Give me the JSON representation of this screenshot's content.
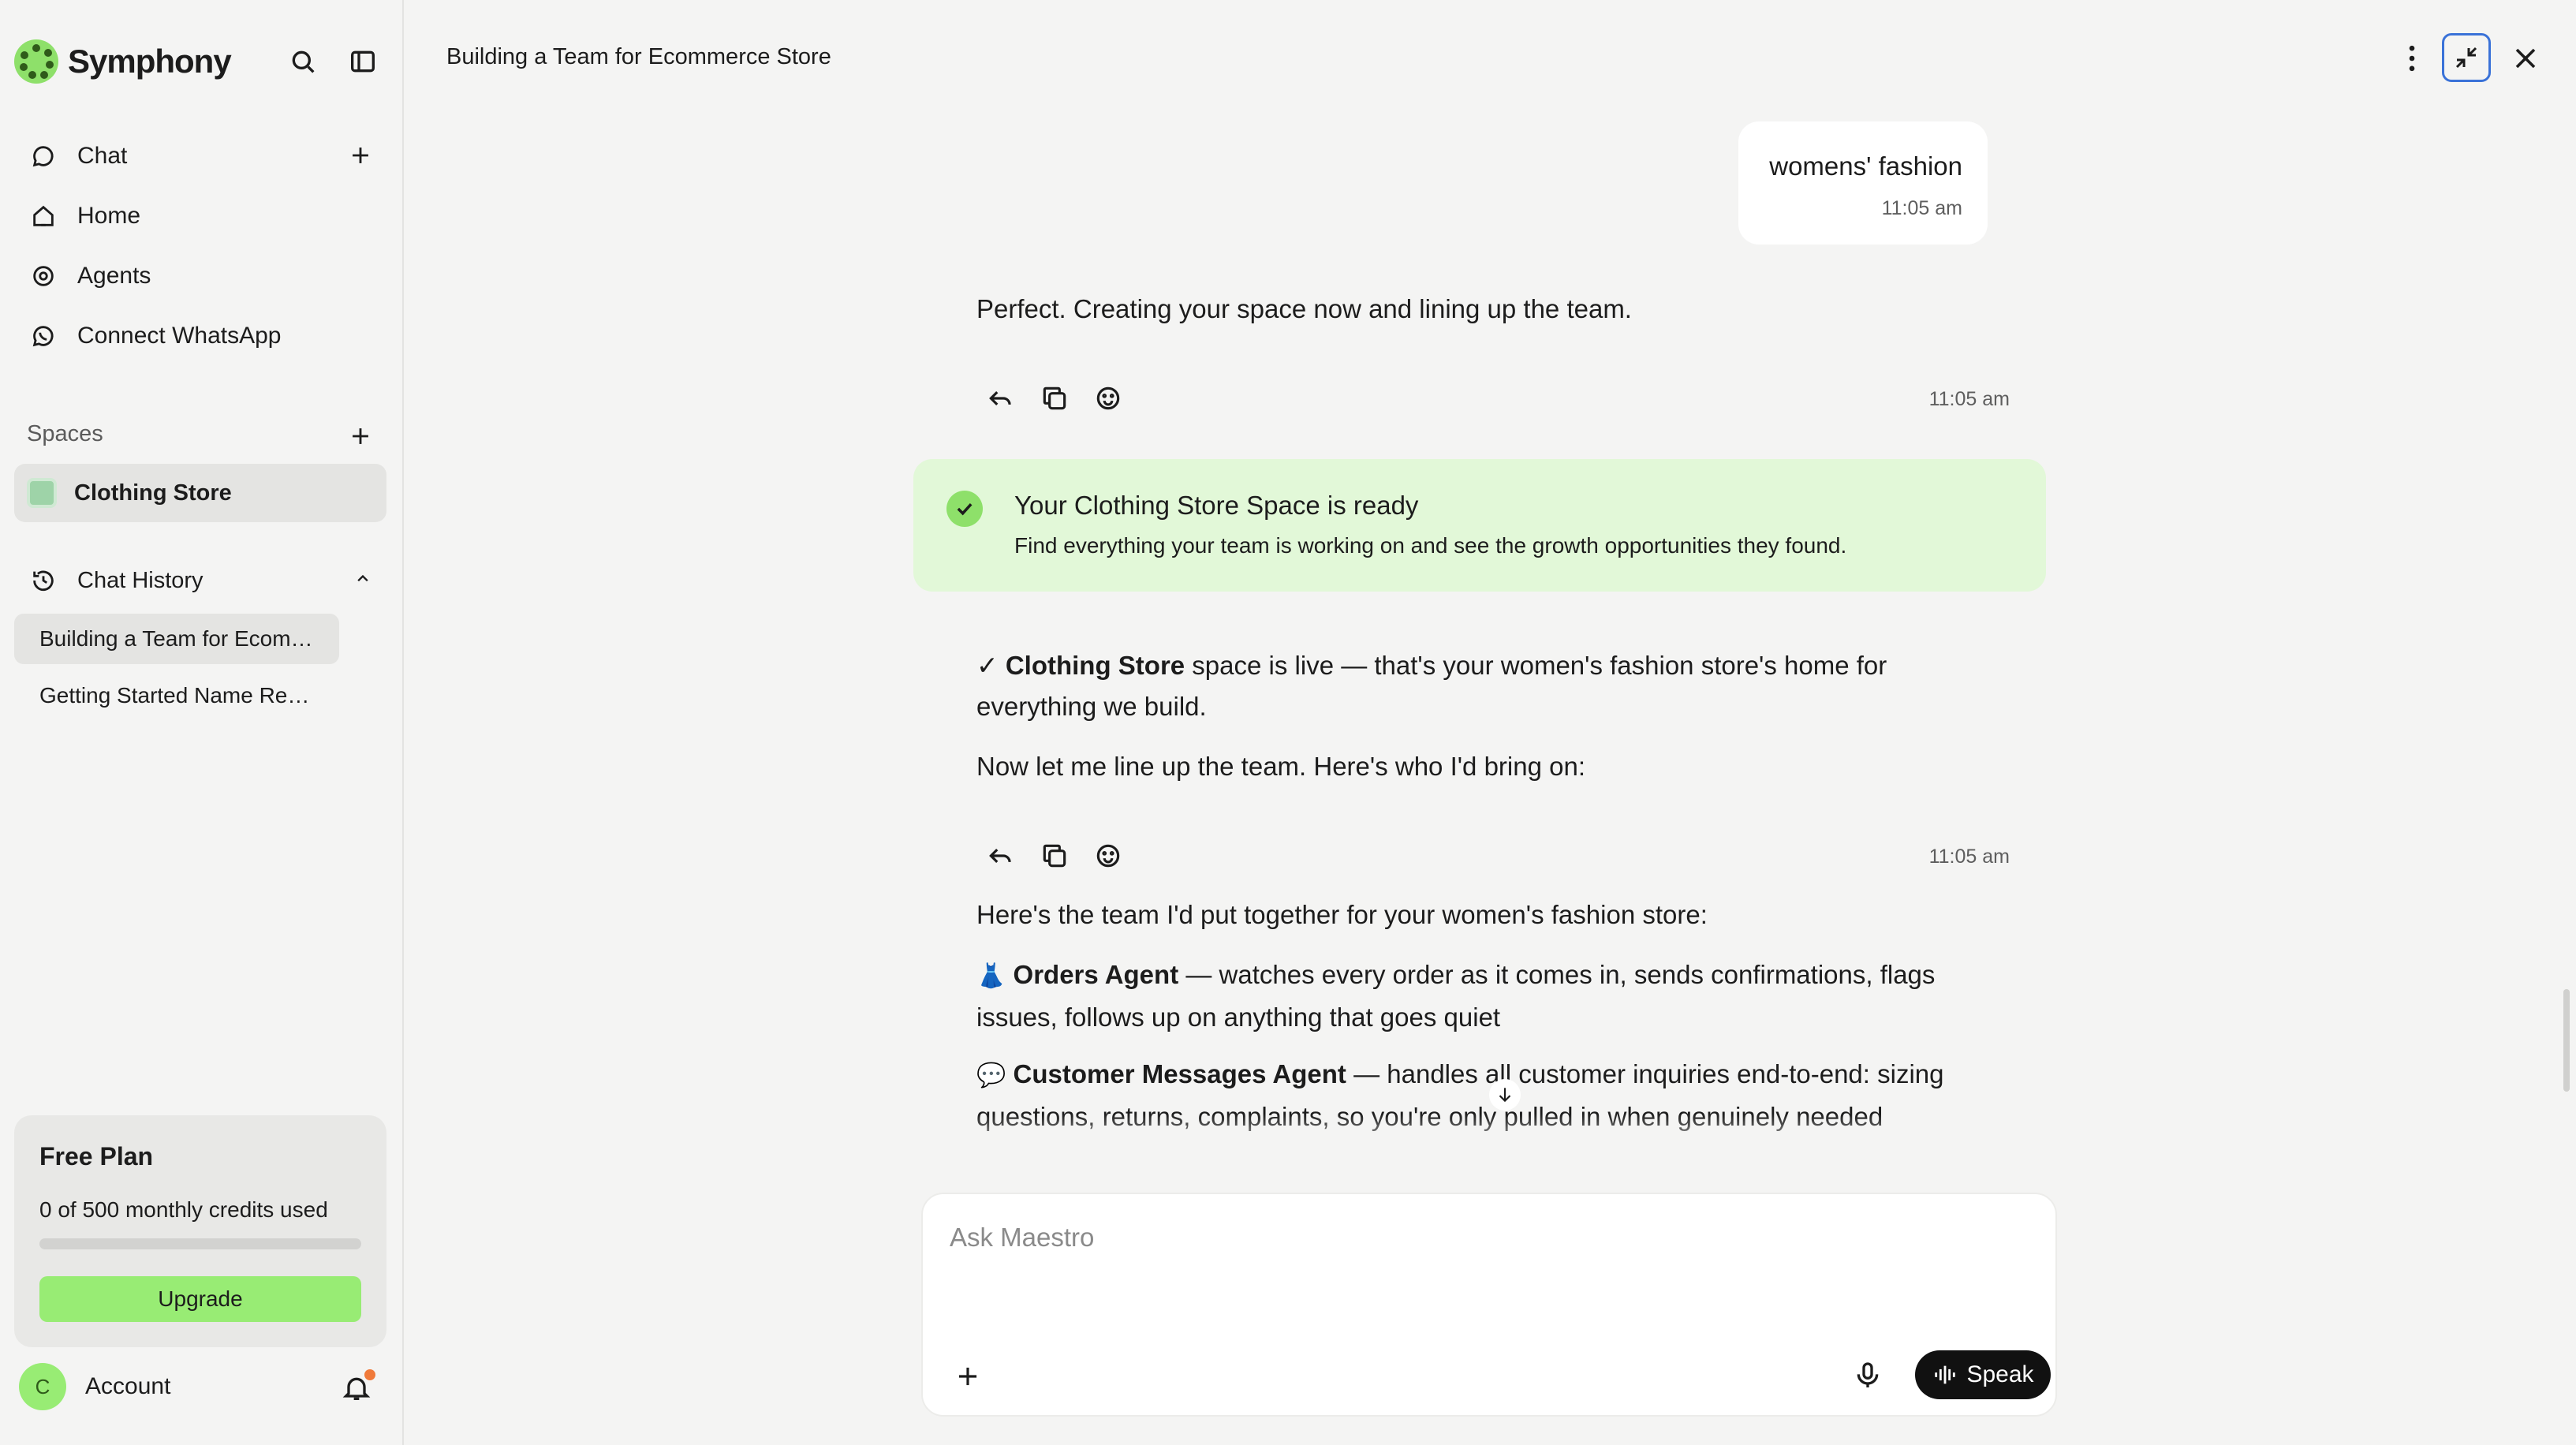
{
  "app": {
    "name": "Symphony",
    "brand_color": "#8ee06a"
  },
  "sidebar": {
    "nav": [
      {
        "label": "Chat",
        "icon": "chat-bubble-icon"
      },
      {
        "label": "Home",
        "icon": "home-icon"
      },
      {
        "label": "Agents",
        "icon": "agents-target-icon"
      },
      {
        "label": "Connect WhatsApp",
        "icon": "whatsapp-icon"
      }
    ],
    "spaces_label": "Spaces",
    "spaces": [
      {
        "label": "Clothing Store"
      }
    ],
    "history_label": "Chat History",
    "history": [
      {
        "label": "Building a Team for Ecom…"
      },
      {
        "label": "Getting Started Name Re…"
      }
    ],
    "plan": {
      "title": "Free Plan",
      "credits": "0 of 500 monthly credits used",
      "credits_used_fraction": 0,
      "upgrade_label": "Upgrade",
      "upgrade_color": "#98ec74"
    },
    "account": {
      "initial": "C",
      "label": "Account",
      "has_notification": true
    }
  },
  "chat": {
    "title": "Building a Team for Ecommerce Store",
    "user_message": {
      "text": "womens' fashion",
      "time": "11:05 am"
    },
    "reply1": {
      "text": "Perfect. Creating your space now and lining up the team.",
      "time": "11:05 am"
    },
    "ready_card": {
      "title": "Your Clothing Store Space is ready",
      "subtitle": "Find everything your team is working on and see the growth opportunities they found."
    },
    "reply2": {
      "check": "✓",
      "space_name": "Clothing Store",
      "line1_rest": " space is live — that's your women's fashion store's home for everything we build.",
      "line2": "Now let me line up the team. Here's who I'd bring on:",
      "time": "11:05 am"
    },
    "reply3": {
      "intro": "Here's the team I'd put together for your women's fashion store:",
      "agents": [
        {
          "emoji": "👗",
          "name": "Orders Agent",
          "desc": " — watches every order as it comes in, sends confirmations, flags issues, follows up on anything that goes quiet"
        },
        {
          "emoji": "💬",
          "name": "Customer Messages Agent",
          "desc": " — handles all customer inquiries end-to-end: sizing questions, returns, complaints, so you're only pulled in when genuinely needed"
        }
      ]
    }
  },
  "composer": {
    "placeholder": "Ask Maestro",
    "speak_label": "Speak"
  }
}
